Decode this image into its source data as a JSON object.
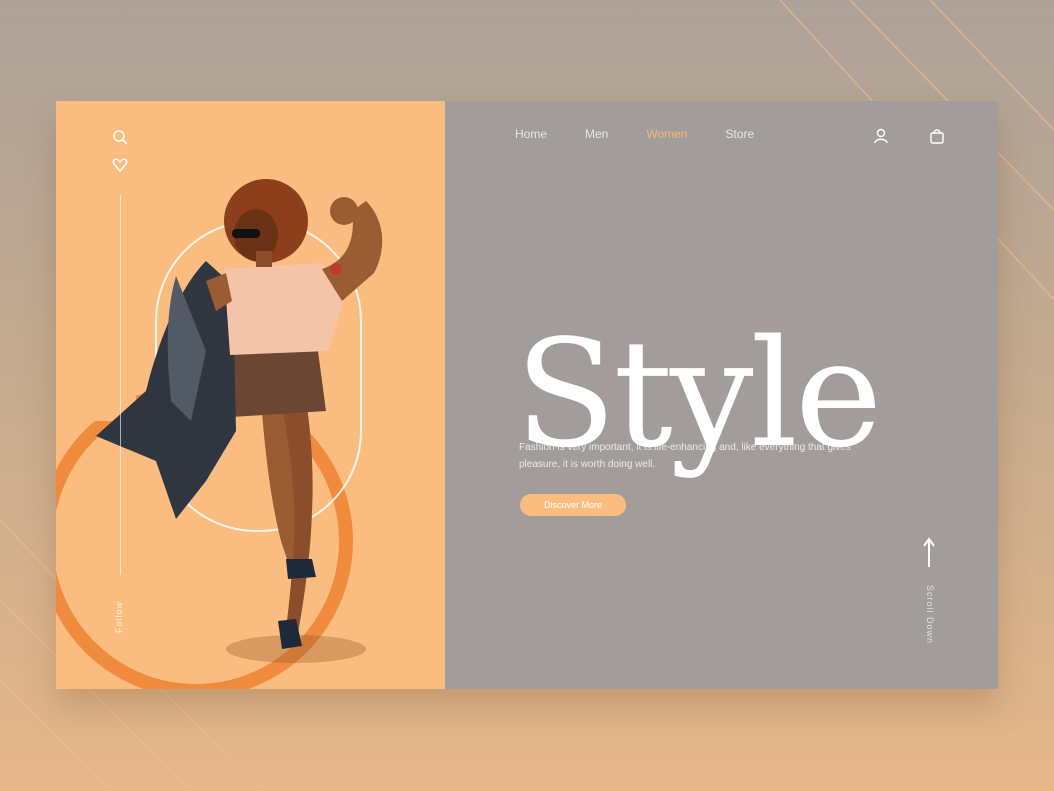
{
  "nav": {
    "items": [
      {
        "label": "Home",
        "active": false
      },
      {
        "label": "Men",
        "active": false
      },
      {
        "label": "Women",
        "active": true
      },
      {
        "label": "Store",
        "active": false
      }
    ]
  },
  "hero": {
    "title": "Style",
    "description": "Fashion is very important, it is life-enhancing and, like everything that gives pleasure, it is worth doing well.",
    "cta_label": "Discover More"
  },
  "rail": {
    "label": "Follow"
  },
  "scroll": {
    "label": "Scroll Down"
  },
  "icons": {
    "search": "search-icon",
    "heart": "heart-icon",
    "user": "user-icon",
    "bag": "shopping-bag-icon",
    "arrow": "arrow-up-icon"
  },
  "colors": {
    "accent": "#fbbd7f",
    "panel_gray": "#a29d9a",
    "ring_orange": "#f08a3c",
    "text_white": "#ffffff"
  }
}
